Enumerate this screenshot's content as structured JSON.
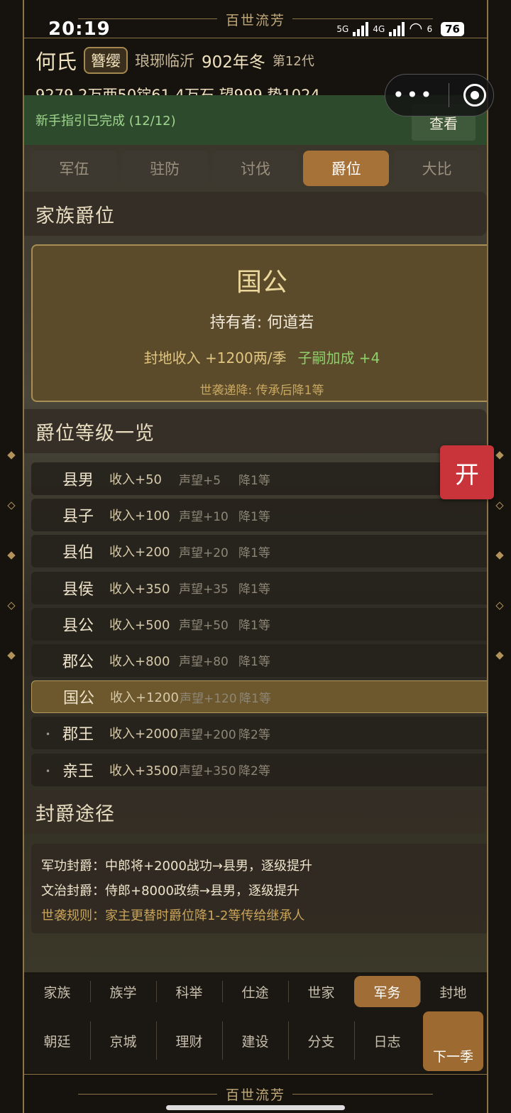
{
  "status_bar": {
    "time": "20:19",
    "net1": "5G",
    "net2": "4G",
    "wifi_extra": "6",
    "battery": "76"
  },
  "brand": "百世流芳",
  "header": {
    "family": "何氏",
    "badge": "簪缨",
    "location": "琅琊临沂",
    "year": "902年冬",
    "generation": "第12代",
    "resources": "9279.2万两50锭61.4万石  望999  势1024"
  },
  "guide": {
    "text": "新手指引已完成 (12/12)",
    "view_label": "查看"
  },
  "tabs": [
    {
      "label": "军伍",
      "active": false
    },
    {
      "label": "驻防",
      "active": false
    },
    {
      "label": "讨伐",
      "active": false
    },
    {
      "label": "爵位",
      "active": true
    },
    {
      "label": "大比",
      "active": false
    }
  ],
  "family_rank": {
    "title": "家族爵位",
    "rank": "国公",
    "holder": "持有者: 何道若",
    "income": "封地收入 +1200两/季",
    "bonus": "子嗣加成 +4",
    "rule": "世袭递降: 传承后降1等"
  },
  "rank_list": {
    "title": "爵位等级一览",
    "rows": [
      {
        "name": "县男",
        "income": "收入+50",
        "prestige": "声望+5",
        "decay": "降1等",
        "current": false,
        "locked": false
      },
      {
        "name": "县子",
        "income": "收入+100",
        "prestige": "声望+10",
        "decay": "降1等",
        "current": false,
        "locked": false
      },
      {
        "name": "县伯",
        "income": "收入+200",
        "prestige": "声望+20",
        "decay": "降1等",
        "current": false,
        "locked": false
      },
      {
        "name": "县侯",
        "income": "收入+350",
        "prestige": "声望+35",
        "decay": "降1等",
        "current": false,
        "locked": false
      },
      {
        "name": "县公",
        "income": "收入+500",
        "prestige": "声望+50",
        "decay": "降1等",
        "current": false,
        "locked": false
      },
      {
        "name": "郡公",
        "income": "收入+800",
        "prestige": "声望+80",
        "decay": "降1等",
        "current": false,
        "locked": false
      },
      {
        "name": "国公",
        "income": "收入+1200",
        "prestige": "声望+120",
        "decay": "降1等",
        "current": true,
        "locked": false
      },
      {
        "name": "郡王",
        "income": "收入+2000",
        "prestige": "声望+200",
        "decay": "降2等",
        "current": false,
        "locked": true
      },
      {
        "name": "亲王",
        "income": "收入+3500",
        "prestige": "声望+350",
        "decay": "降2等",
        "current": false,
        "locked": true
      }
    ]
  },
  "paths": {
    "title": "封爵途径",
    "military": "军功封爵：中郎将+2000战功→县男，逐级提升",
    "civil": "文治封爵：侍郎+8000政绩→县男，逐级提升",
    "rule": "世袭规则：家主更替时爵位降1-2等传给继承人"
  },
  "open_button": "开",
  "nav": {
    "row1": [
      {
        "label": "家族",
        "active": false
      },
      {
        "label": "族学",
        "active": false
      },
      {
        "label": "科举",
        "active": false
      },
      {
        "label": "仕途",
        "active": false
      },
      {
        "label": "世家",
        "active": false
      },
      {
        "label": "军务",
        "active": true
      },
      {
        "label": "封地",
        "active": false
      }
    ],
    "row2": [
      {
        "label": "朝廷"
      },
      {
        "label": "京城"
      },
      {
        "label": "理财"
      },
      {
        "label": "建设"
      },
      {
        "label": "分支"
      },
      {
        "label": "日志"
      }
    ],
    "next_season": "下一季"
  },
  "colors": {
    "accent": "#a77238",
    "gold": "#c9a45a",
    "green": "#8ed06a",
    "open": "#c8343a"
  }
}
